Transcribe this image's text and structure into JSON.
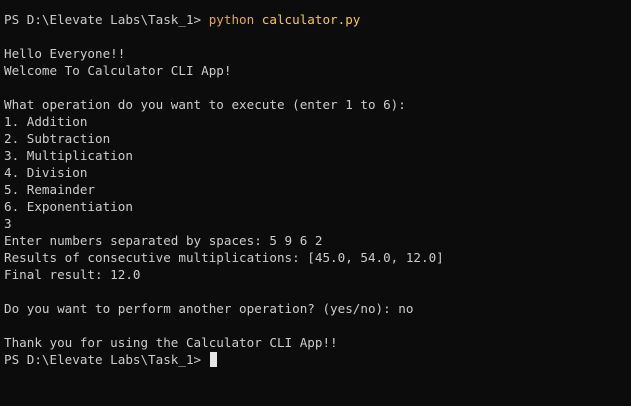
{
  "terminal": {
    "colors": {
      "background": "#0c0c0c",
      "foreground": "#cccccc",
      "command": "#f9c74f",
      "cursor": "#e6e6e6"
    },
    "prompt1": {
      "path": "PS D:\\Elevate Labs\\Task_1> ",
      "command_program": "python",
      "command_arg": " calculator.py"
    },
    "lines": [
      "",
      "Hello Everyone!!",
      "Welcome To Calculator CLI App!",
      "",
      "What operation do you want to execute (enter 1 to 6):",
      "1. Addition",
      "2. Subtraction",
      "3. Multiplication",
      "4. Division",
      "5. Remainder",
      "6. Exponentiation",
      "3",
      "Enter numbers separated by spaces: 5 9 6 2",
      "Results of consecutive multiplications: [45.0, 54.0, 12.0]",
      "Final result: 12.0",
      "",
      "Do you want to perform another operation? (yes/no): no",
      "",
      "Thank you for using the Calculator CLI App!!"
    ],
    "prompt2": {
      "path": "PS D:\\Elevate Labs\\Task_1> "
    }
  }
}
